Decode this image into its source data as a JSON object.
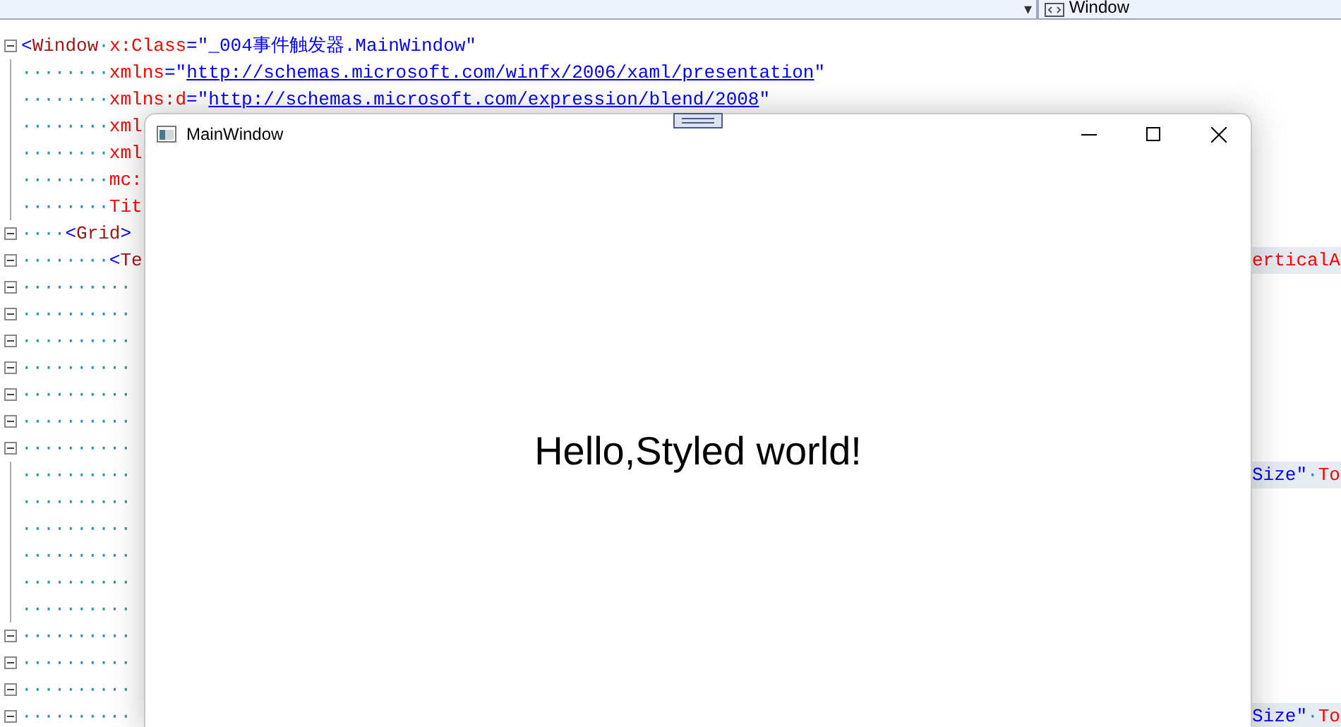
{
  "top_bar": {
    "dropdown_caret": "▾",
    "element_selector": "Window"
  },
  "editor_lines": [
    {
      "foldable": true,
      "segments": [
        {
          "kind": "punct",
          "text": "<"
        },
        {
          "kind": "element",
          "text": "Window"
        },
        {
          "kind": "ws",
          "text": "·"
        },
        {
          "kind": "attribute",
          "text": "x:Class"
        },
        {
          "kind": "punct",
          "text": "="
        },
        {
          "kind": "string",
          "text": "\"_004事件触发器.MainWindow\""
        }
      ]
    },
    {
      "foldable": false,
      "segments": [
        {
          "kind": "ws",
          "text": "········"
        },
        {
          "kind": "attribute",
          "text": "xmlns"
        },
        {
          "kind": "punct",
          "text": "="
        },
        {
          "kind": "string",
          "text": "\""
        },
        {
          "kind": "link",
          "text": "http://schemas.microsoft.com/winfx/2006/xaml/presentation"
        },
        {
          "kind": "string",
          "text": "\""
        }
      ]
    },
    {
      "foldable": false,
      "segments": [
        {
          "kind": "ws",
          "text": "········"
        },
        {
          "kind": "attribute",
          "text": "xmlns:d"
        },
        {
          "kind": "punct",
          "text": "="
        },
        {
          "kind": "string",
          "text": "\""
        },
        {
          "kind": "link",
          "text": "http://schemas.microsoft.com/expression/blend/2008"
        },
        {
          "kind": "string",
          "text": "\""
        }
      ]
    },
    {
      "foldable": false,
      "segments": [
        {
          "kind": "ws",
          "text": "········"
        },
        {
          "kind": "attribute",
          "text": "xml"
        }
      ]
    },
    {
      "foldable": false,
      "segments": [
        {
          "kind": "ws",
          "text": "········"
        },
        {
          "kind": "attribute",
          "text": "xml"
        }
      ]
    },
    {
      "foldable": false,
      "segments": [
        {
          "kind": "ws",
          "text": "········"
        },
        {
          "kind": "attribute",
          "text": "mc:"
        }
      ]
    },
    {
      "foldable": false,
      "segments": [
        {
          "kind": "ws",
          "text": "········"
        },
        {
          "kind": "attribute",
          "text": "Tit"
        }
      ]
    },
    {
      "foldable": true,
      "segments": [
        {
          "kind": "ws",
          "text": "····"
        },
        {
          "kind": "punct",
          "text": "<"
        },
        {
          "kind": "element",
          "text": "Grid"
        },
        {
          "kind": "punct",
          "text": ">"
        }
      ]
    },
    {
      "foldable": true,
      "segments": [
        {
          "kind": "ws",
          "text": "········"
        },
        {
          "kind": "punct",
          "text": "<"
        },
        {
          "kind": "element",
          "text": "Te"
        }
      ],
      "right": [
        {
          "kind": "attribute",
          "text": "erticalA"
        }
      ]
    },
    {
      "foldable": true,
      "segments": [
        {
          "kind": "ws",
          "text": "··········"
        }
      ]
    },
    {
      "foldable": true,
      "segments": [
        {
          "kind": "ws",
          "text": "··········"
        }
      ]
    },
    {
      "foldable": true,
      "segments": [
        {
          "kind": "ws",
          "text": "··········"
        }
      ]
    },
    {
      "foldable": true,
      "segments": [
        {
          "kind": "ws",
          "text": "··········"
        }
      ]
    },
    {
      "foldable": true,
      "segments": [
        {
          "kind": "ws",
          "text": "··········"
        }
      ]
    },
    {
      "foldable": true,
      "segments": [
        {
          "kind": "ws",
          "text": "··········"
        }
      ]
    },
    {
      "foldable": true,
      "segments": [
        {
          "kind": "ws",
          "text": "··········"
        }
      ]
    },
    {
      "foldable": false,
      "segments": [
        {
          "kind": "ws",
          "text": "··········"
        }
      ],
      "right": [
        {
          "kind": "string",
          "text": "Size\""
        },
        {
          "kind": "ws",
          "text": "·"
        },
        {
          "kind": "attribute",
          "text": "To"
        }
      ]
    },
    {
      "foldable": false,
      "segments": [
        {
          "kind": "ws",
          "text": "··········"
        }
      ]
    },
    {
      "foldable": false,
      "segments": [
        {
          "kind": "ws",
          "text": "··········"
        }
      ]
    },
    {
      "foldable": false,
      "segments": [
        {
          "kind": "ws",
          "text": "··········"
        }
      ]
    },
    {
      "foldable": false,
      "segments": [
        {
          "kind": "ws",
          "text": "··········"
        }
      ]
    },
    {
      "foldable": false,
      "segments": [
        {
          "kind": "ws",
          "text": "··········"
        }
      ]
    },
    {
      "foldable": true,
      "segments": [
        {
          "kind": "ws",
          "text": "··········"
        }
      ]
    },
    {
      "foldable": true,
      "segments": [
        {
          "kind": "ws",
          "text": "··········"
        }
      ]
    },
    {
      "foldable": true,
      "segments": [
        {
          "kind": "ws",
          "text": "··········"
        }
      ]
    },
    {
      "foldable": true,
      "segments": [
        {
          "kind": "ws",
          "text": "··········"
        }
      ],
      "right": [
        {
          "kind": "string",
          "text": "Size\""
        },
        {
          "kind": "ws",
          "text": "·"
        },
        {
          "kind": "attribute",
          "text": "To"
        }
      ]
    }
  ],
  "window": {
    "title": "MainWindow",
    "content": "Hello,Styled world!"
  }
}
